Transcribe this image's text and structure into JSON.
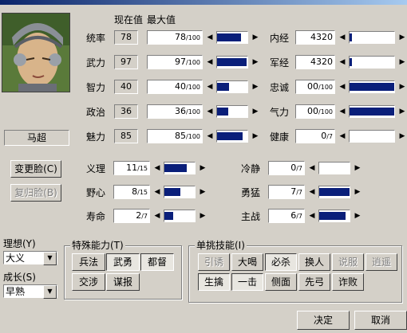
{
  "header": {
    "current_label": "现在值",
    "max_label": "最大值"
  },
  "portrait": {
    "name": "马超"
  },
  "buttons": {
    "change_face": "变更脸(C)",
    "restore_face": "复归脸(B)",
    "ok": "决定",
    "cancel": "取消"
  },
  "left_stats": [
    {
      "label": "统率",
      "current": "78",
      "value": "78",
      "max": "/100",
      "fill": 0.78
    },
    {
      "label": "武力",
      "current": "97",
      "value": "97",
      "max": "/100",
      "fill": 0.97
    },
    {
      "label": "智力",
      "current": "40",
      "value": "40",
      "max": "/100",
      "fill": 0.4
    },
    {
      "label": "政治",
      "current": "36",
      "value": "36",
      "max": "/100",
      "fill": 0.36
    },
    {
      "label": "魅力",
      "current": "85",
      "value": "85",
      "max": "/100",
      "fill": 0.85
    }
  ],
  "right_stats": [
    {
      "label": "内经",
      "value": "4320",
      "fill": 0.06
    },
    {
      "label": "军经",
      "value": "4320",
      "fill": 0.06
    },
    {
      "label": "忠诚",
      "value": "00",
      "max": "/100",
      "fill": 1.0
    },
    {
      "label": "气力",
      "value": "00",
      "max": "/100",
      "fill": 1.0
    },
    {
      "label": "健康",
      "value": "0",
      "max": "/7",
      "fill": 0.0
    }
  ],
  "mid_stats": [
    {
      "label": "义理",
      "value": "11",
      "max": "/15",
      "fill": 0.73
    },
    {
      "label": "野心",
      "value": "8",
      "max": "/15",
      "fill": 0.53
    },
    {
      "label": "寿命",
      "value": "2",
      "max": "/7",
      "fill": 0.28
    }
  ],
  "mid_right_stats": [
    {
      "label": "冷静",
      "value": "0",
      "max": "/7",
      "fill": 0.0
    },
    {
      "label": "勇猛",
      "value": "7",
      "max": "/7",
      "fill": 1.0
    },
    {
      "label": "主战",
      "value": "6",
      "max": "/7",
      "fill": 0.86
    }
  ],
  "ideal": {
    "label": "理想(Y)",
    "value": "大义"
  },
  "growth": {
    "label": "成长(S)",
    "value": "早熟"
  },
  "special": {
    "title": "特殊能力(T)",
    "items": [
      {
        "label": "兵法",
        "state": "normal"
      },
      {
        "label": "武勇",
        "state": "on"
      },
      {
        "label": "都督",
        "state": "on"
      },
      {
        "label": "交涉",
        "state": "normal"
      },
      {
        "label": "谋报",
        "state": "normal"
      }
    ]
  },
  "duel": {
    "title": "单挑技能(I)",
    "items": [
      {
        "label": "引诱",
        "state": "off"
      },
      {
        "label": "大喝",
        "state": "normal"
      },
      {
        "label": "必杀",
        "state": "on"
      },
      {
        "label": "换人",
        "state": "normal"
      },
      {
        "label": "说服",
        "state": "off"
      },
      {
        "label": "逍遥",
        "state": "off"
      },
      {
        "label": "生擒",
        "state": "on"
      },
      {
        "label": "一击",
        "state": "on"
      },
      {
        "label": "侧面",
        "state": "normal"
      },
      {
        "label": "先弓",
        "state": "normal"
      },
      {
        "label": "诈败",
        "state": "normal"
      }
    ]
  },
  "arrows": {
    "left": "◀",
    "right": "▶",
    "down": "▼"
  },
  "colors": {
    "bar_fill": "#0a1f7a",
    "face": "#d4d0c8"
  }
}
